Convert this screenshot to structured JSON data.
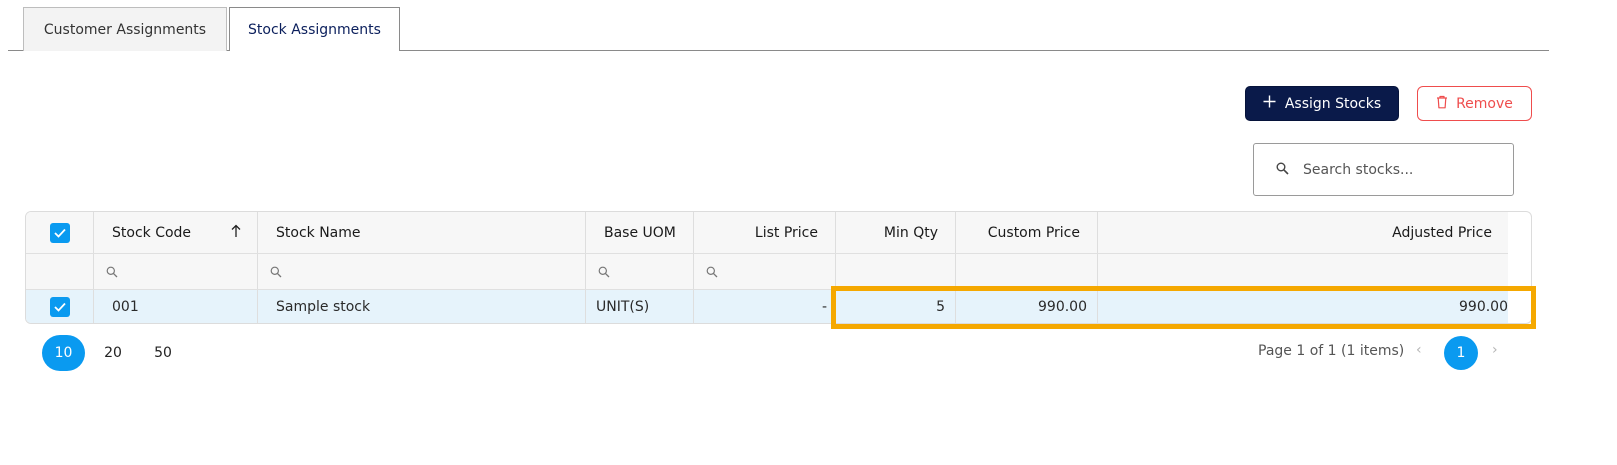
{
  "tabs": [
    {
      "label": "Customer Assignments",
      "active": false
    },
    {
      "label": "Stock Assignments",
      "active": true
    }
  ],
  "toolbar": {
    "assign_label": "Assign Stocks",
    "remove_label": "Remove"
  },
  "search": {
    "placeholder": "Search stocks...",
    "value": ""
  },
  "grid": {
    "columns": [
      "Stock Code",
      "Stock Name",
      "Base UOM",
      "List Price",
      "Min Qty",
      "Custom Price",
      "Adjusted Price"
    ],
    "sort": {
      "column": "Stock Code",
      "direction": "ascending"
    },
    "header_checked": true,
    "rows": [
      {
        "checked": true,
        "stock_code": "001",
        "stock_name": "Sample stock",
        "base_uom": "UNIT(S)",
        "list_price": "-",
        "min_qty": "5",
        "custom_price": "990.00",
        "adjusted_price": "990.00"
      }
    ]
  },
  "pager": {
    "page_sizes": [
      "10",
      "20",
      "50"
    ],
    "selected_page_size": "10",
    "info": "Page 1 of 1 (1 items)",
    "current_page": "1"
  },
  "colors": {
    "primary": "#0a1a4a",
    "accent": "#0a9af0",
    "danger": "#ef4d4d",
    "highlight": "#f5a800",
    "selected_row": "#e6f3fb"
  },
  "icons": {
    "plus": "plus-icon",
    "trash": "trash-icon",
    "search": "search-icon",
    "sort": "sort-ascending-icon",
    "check": "check-icon",
    "prev": "chevron-left-icon",
    "next": "chevron-right-icon"
  }
}
